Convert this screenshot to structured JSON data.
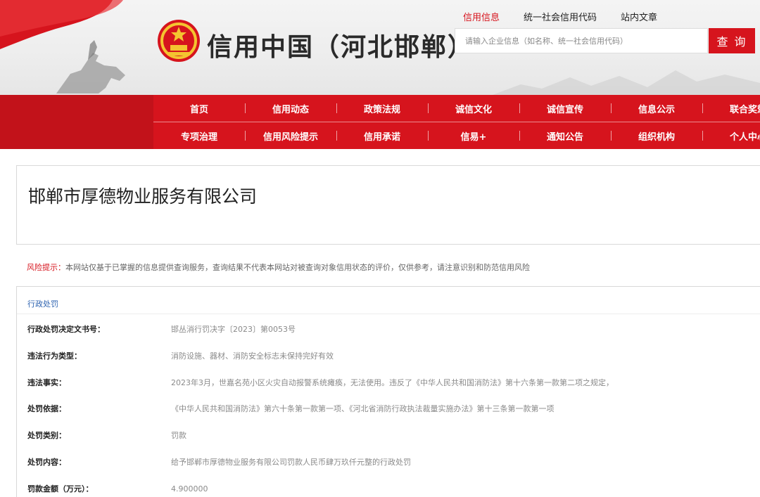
{
  "site": {
    "title": "信用中国（河北邯郸）",
    "top_links": [
      "信用信息",
      "统一社会信用代码",
      "站内文章"
    ],
    "active_top_link": "信用信息",
    "search": {
      "placeholder": "请输入企业信息（如名称、统一社会信用代码）",
      "button": "查 询"
    },
    "accent_color": "#d6141d"
  },
  "nav": {
    "row1": [
      "首页",
      "信用动态",
      "政策法规",
      "诚信文化",
      "诚信宣传",
      "信息公示",
      "联合奖惩"
    ],
    "row2": [
      "专项治理",
      "信用风险提示",
      "信用承诺",
      "信易+",
      "通知公告",
      "组织机构",
      "个人中心"
    ]
  },
  "company": {
    "name": "邯郸市厚德物业服务有限公司"
  },
  "risk_tip": {
    "label": "风险提示：",
    "text": "本网站仅基于已掌握的信息提供查询服务，查询结果不代表本网站对被查询对象信用状态的评价，仅供参考，请注意识别和防范信用风险"
  },
  "penalty": {
    "section_title": "行政处罚",
    "fields": [
      {
        "label": "行政处罚决定文书号：",
        "value": "邯丛消行罚决字〔2023〕第0053号"
      },
      {
        "label": "违法行为类型：",
        "value": "消防设施、器材、消防安全标志未保持完好有效"
      },
      {
        "label": "违法事实：",
        "value": "2023年3月，世嘉名苑小区火灾自动报警系统瘫痪，无法使用。违反了《中华人民共和国消防法》第十六条第一款第二项之规定，"
      },
      {
        "label": "处罚依据：",
        "value": "《中华人民共和国消防法》第六十条第一款第一项、《河北省消防行政执法裁量实施办法》第十三条第一款第一项"
      },
      {
        "label": "处罚类别：",
        "value": "罚款"
      },
      {
        "label": "处罚内容：",
        "value": "给予邯郸市厚德物业服务有限公司罚款人民币肆万玖仟元整的行政处罚"
      },
      {
        "label": "罚款金额（万元）：",
        "value": "4.900000"
      }
    ]
  }
}
